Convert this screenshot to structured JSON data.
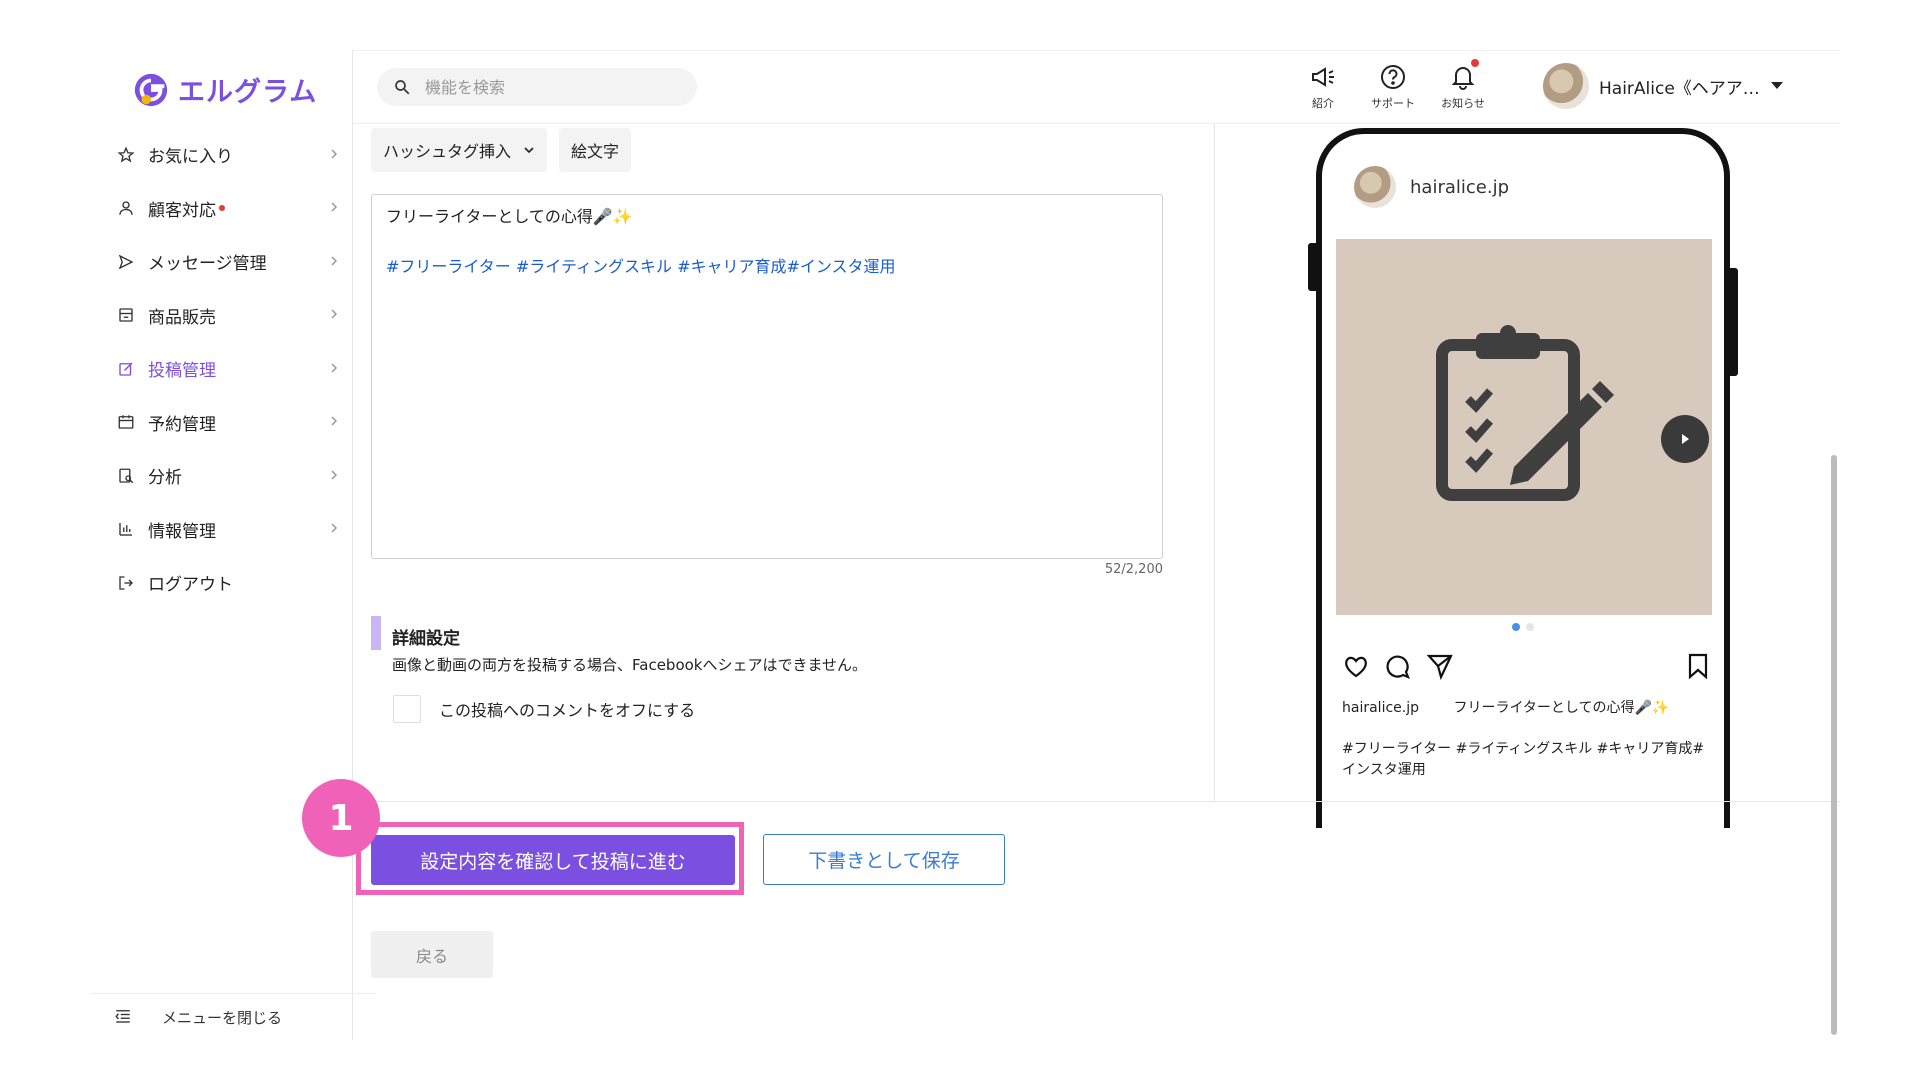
{
  "app": {
    "name": "エルグラム"
  },
  "sidebar": {
    "items": [
      {
        "label": "お気に入り",
        "icon": "star-icon",
        "active": false,
        "badge": false,
        "chevron": true
      },
      {
        "label": "顧客対応",
        "icon": "user-icon",
        "active": false,
        "badge": true,
        "chevron": true
      },
      {
        "label": "メッセージ管理",
        "icon": "send-icon",
        "active": false,
        "badge": false,
        "chevron": true
      },
      {
        "label": "商品販売",
        "icon": "shop-icon",
        "active": false,
        "badge": false,
        "chevron": true
      },
      {
        "label": "投稿管理",
        "icon": "edit-icon",
        "active": true,
        "badge": false,
        "chevron": true
      },
      {
        "label": "予約管理",
        "icon": "calendar-icon",
        "active": false,
        "badge": false,
        "chevron": true
      },
      {
        "label": "分析",
        "icon": "analysis-icon",
        "active": false,
        "badge": false,
        "chevron": true
      },
      {
        "label": "情報管理",
        "icon": "chart-icon",
        "active": false,
        "badge": false,
        "chevron": true
      },
      {
        "label": "ログアウト",
        "icon": "logout-icon",
        "active": false,
        "badge": false,
        "chevron": false
      }
    ],
    "close_label": "メニューを閉じる"
  },
  "header": {
    "search_placeholder": "機能を検索",
    "icons": [
      {
        "label": "紹介",
        "icon": "megaphone-icon"
      },
      {
        "label": "サポート",
        "icon": "help-icon"
      },
      {
        "label": "お知らせ",
        "icon": "bell-icon"
      }
    ],
    "user_name": "HairAlice《ヘアア…"
  },
  "editor": {
    "hashtag_button": "ハッシュタグ挿入",
    "emoji_button": "絵文字",
    "caption_line": "フリーライターとしての心得🎤✨",
    "hashtags": "#フリーライター #ライティングスキル #キャリア育成#インスタ運用",
    "counter": "52/2,200"
  },
  "settings": {
    "title": "詳細設定",
    "note": "画像と動画の両方を投稿する場合、Facebookへシェアはできません。",
    "comment_off_label": "この投稿へのコメントをオフにする",
    "comment_off_checked": false
  },
  "preview": {
    "username": "hairalice.jp",
    "caption_user": "hairalice.jp",
    "caption_text": "フリーライターとしての心得🎤✨",
    "caption_tags": "#フリーライター #ライティングスキル #キャリア育成#インスタ運用",
    "image_bg": "#d7c9bb",
    "slides": 2,
    "current_slide": 1
  },
  "actions": {
    "callout_number": "1",
    "confirm_label": "設定内容を確認して投稿に進む",
    "draft_label": "下書きとして保存",
    "back_label": "戻る"
  },
  "colors": {
    "brand": "#7b4fe0",
    "highlight": "#f062b8",
    "link_blue": "#3a7bd5",
    "hashtag_blue": "#1a5dd0"
  }
}
